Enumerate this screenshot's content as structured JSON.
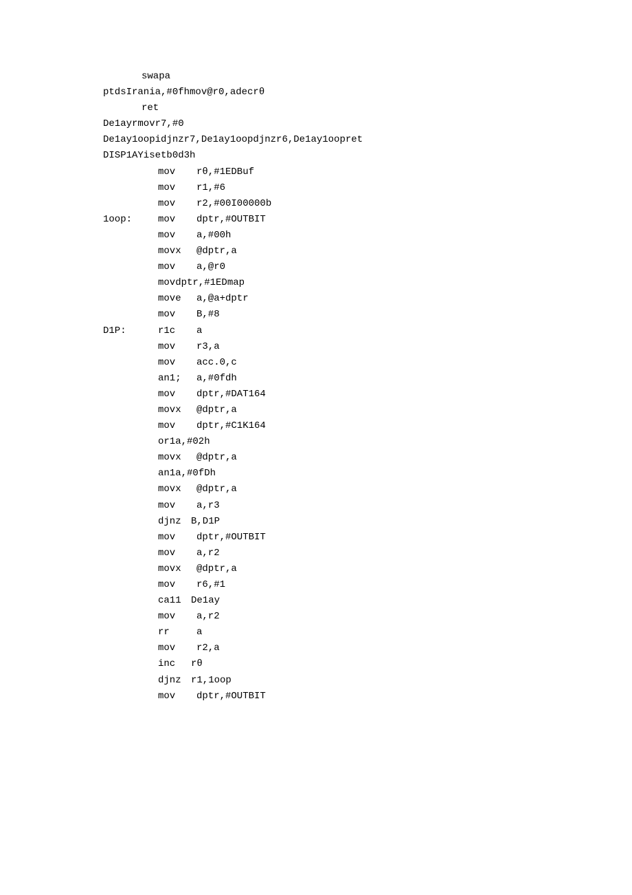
{
  "lines": {
    "l1": "swapa",
    "l2": "ptdsIrania,#0fhmov@r0,adecrθ",
    "l3": "ret",
    "l4": "De1ayrmovr7,#0",
    "l5": "De1ay1oopidjnzr7,De1ay1oopdjnzr6,De1ay1oopret",
    "l6": "DISP1AYisetb0d3h"
  },
  "labels": {
    "loop": "1oop:",
    "dlp": "D1P:"
  },
  "rows": [
    {
      "label": "",
      "op": "mov",
      "arg": "rθ,#1EDBuf"
    },
    {
      "label": "",
      "op": "mov",
      "arg": "r1,#6"
    },
    {
      "label": "",
      "op": "mov",
      "arg": "r2,#00I00000b"
    },
    {
      "label": "1oop:",
      "op": "mov",
      "arg": "dptr,#OUTBIT"
    },
    {
      "label": "",
      "op": "mov",
      "arg": "a,#00h"
    },
    {
      "label": "",
      "op": "movx",
      "arg": "@dptr,a"
    },
    {
      "label": "",
      "op": "mov",
      "arg": "a,@r0"
    },
    {
      "label": "",
      "raw": "movdptr,#1EDmap"
    },
    {
      "label": "",
      "op": "move",
      "arg": "a,@a+dptr"
    },
    {
      "label": "",
      "op": "mov",
      "arg": "B,#8"
    },
    {
      "label": "D1P:",
      "op": "r1c",
      "arg": "a"
    },
    {
      "label": "",
      "op": "mov",
      "arg": "r3,a"
    },
    {
      "label": "",
      "op": "mov",
      "arg": "acc.0,c"
    },
    {
      "label": "",
      "op": "an1;",
      "arg": "a,#0fdh"
    },
    {
      "label": "",
      "op": "mov",
      "arg": "dptr,#DAT164"
    },
    {
      "label": "",
      "op": "movx",
      "arg": "@dptr,a"
    },
    {
      "label": "",
      "op": "mov",
      "arg": "dptr,#C1K164"
    },
    {
      "label": "",
      "raw": "or1a,#02h"
    },
    {
      "label": "",
      "op": "movx",
      "arg": "@dptr,a"
    },
    {
      "label": "",
      "raw": "an1a,#0fDh"
    },
    {
      "label": "",
      "op": "movx",
      "arg": "@dptr,a"
    },
    {
      "label": "",
      "op": "mov",
      "arg": "a,r3"
    },
    {
      "label": "",
      "op": "djnz",
      "arg": "B,D1P"
    },
    {
      "label": "",
      "op": "mov",
      "arg": "dptr,#OUTBIT"
    },
    {
      "label": "",
      "op": "mov",
      "arg": "a,r2"
    },
    {
      "label": "",
      "op": "movx",
      "arg": "@dptr,a"
    },
    {
      "label": "",
      "op": "mov",
      "arg": "r6,#1"
    },
    {
      "label": "",
      "op": "ca11",
      "arg": "De1ay"
    },
    {
      "label": "",
      "op": "mov",
      "arg": "a,r2"
    },
    {
      "label": "",
      "op": "rr",
      "arg": "a"
    },
    {
      "label": "",
      "op": "mov",
      "arg": "r2,a"
    },
    {
      "label": "",
      "op": "inc",
      "arg": "rθ"
    },
    {
      "label": "",
      "op": "djnz",
      "arg": "r1,1oop"
    },
    {
      "label": "",
      "op": "mov",
      "arg": "dptr,#OUTBIT"
    }
  ]
}
